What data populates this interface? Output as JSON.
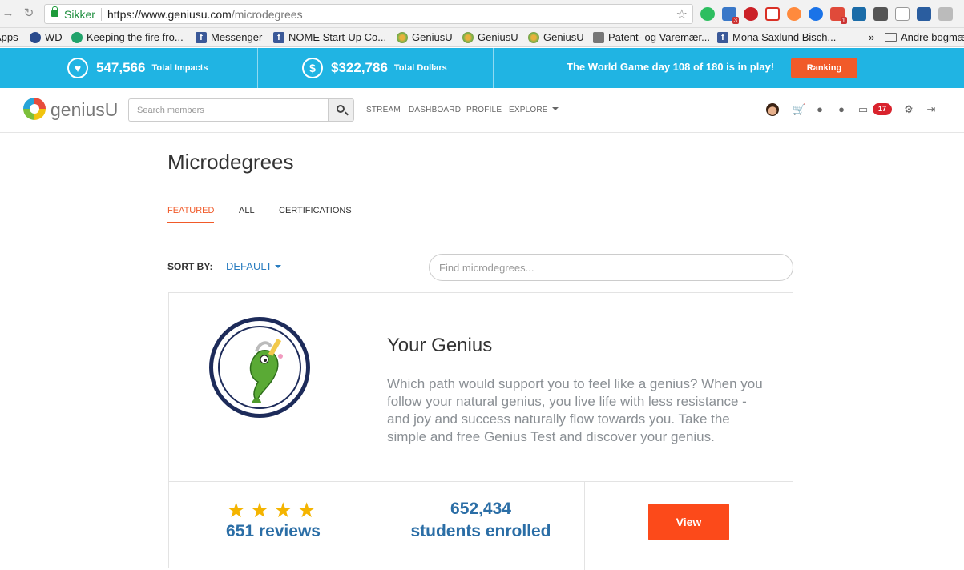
{
  "browser": {
    "secure_label": "Sikker",
    "url_prefix": "https://www.geniusu.com",
    "url_path": "/microdegrees",
    "bookmarks": [
      {
        "label": "Apps",
        "icon": "apps-icon"
      },
      {
        "label": "WD",
        "icon": "wd-icon"
      },
      {
        "label": "Keeping the fire fro...",
        "icon": "keeping-fire-icon"
      },
      {
        "label": "Messenger",
        "icon": "facebook-icon"
      },
      {
        "label": "NOME Start-Up Co...",
        "icon": "facebook-icon"
      },
      {
        "label": "GeniusU",
        "icon": "geniusu-icon"
      },
      {
        "label": "GeniusU",
        "icon": "geniusu-icon"
      },
      {
        "label": "GeniusU",
        "icon": "geniusu-icon"
      },
      {
        "label": "Patent- og Varemær...",
        "icon": "patent-icon"
      },
      {
        "label": "Mona Saxlund Bisch...",
        "icon": "facebook-icon"
      }
    ],
    "more_bookmarks": "»",
    "other_bookmarks": "Andre bogmær",
    "extension_badges": {
      "mail": "3",
      "google": "1"
    }
  },
  "impact_bar": {
    "impacts_value": "547,566",
    "impacts_label": "Total Impacts",
    "dollars_value": "$322,786",
    "dollars_label": "Total Dollars",
    "game_text": "The World Game day 108 of 180 is in play!",
    "ranking_label": "Ranking"
  },
  "header": {
    "logo_text": "geniusU",
    "search_placeholder": "Search members",
    "nav": [
      "STREAM",
      "DASHBOARD",
      "PROFILE",
      "EXPLORE"
    ],
    "notification_count": "17"
  },
  "main": {
    "title": "Microdegrees",
    "tabs": [
      "FEATURED",
      "ALL",
      "CERTIFICATIONS"
    ],
    "active_tab": "FEATURED",
    "sort_label": "SORT BY:",
    "sort_value": "DEFAULT",
    "find_placeholder": "Find microdegrees..."
  },
  "card": {
    "title": "Your Genius",
    "description": "Which path would support you to feel like a genius? When you follow your natural genius, you live life with less resistance - and joy and success naturally flow towards you. Take the simple and free Genius Test and discover your genius.",
    "rating_stars": 4,
    "reviews": "651 reviews",
    "students_count": "652,434",
    "students_label": "students enrolled",
    "view_label": "View"
  },
  "colors": {
    "impact_bar": "#20b4e3",
    "accent_orange": "#f15a29",
    "view_button": "#fc4a1a",
    "stat_blue": "#2b6ea6",
    "star_gold": "#f4b400"
  }
}
